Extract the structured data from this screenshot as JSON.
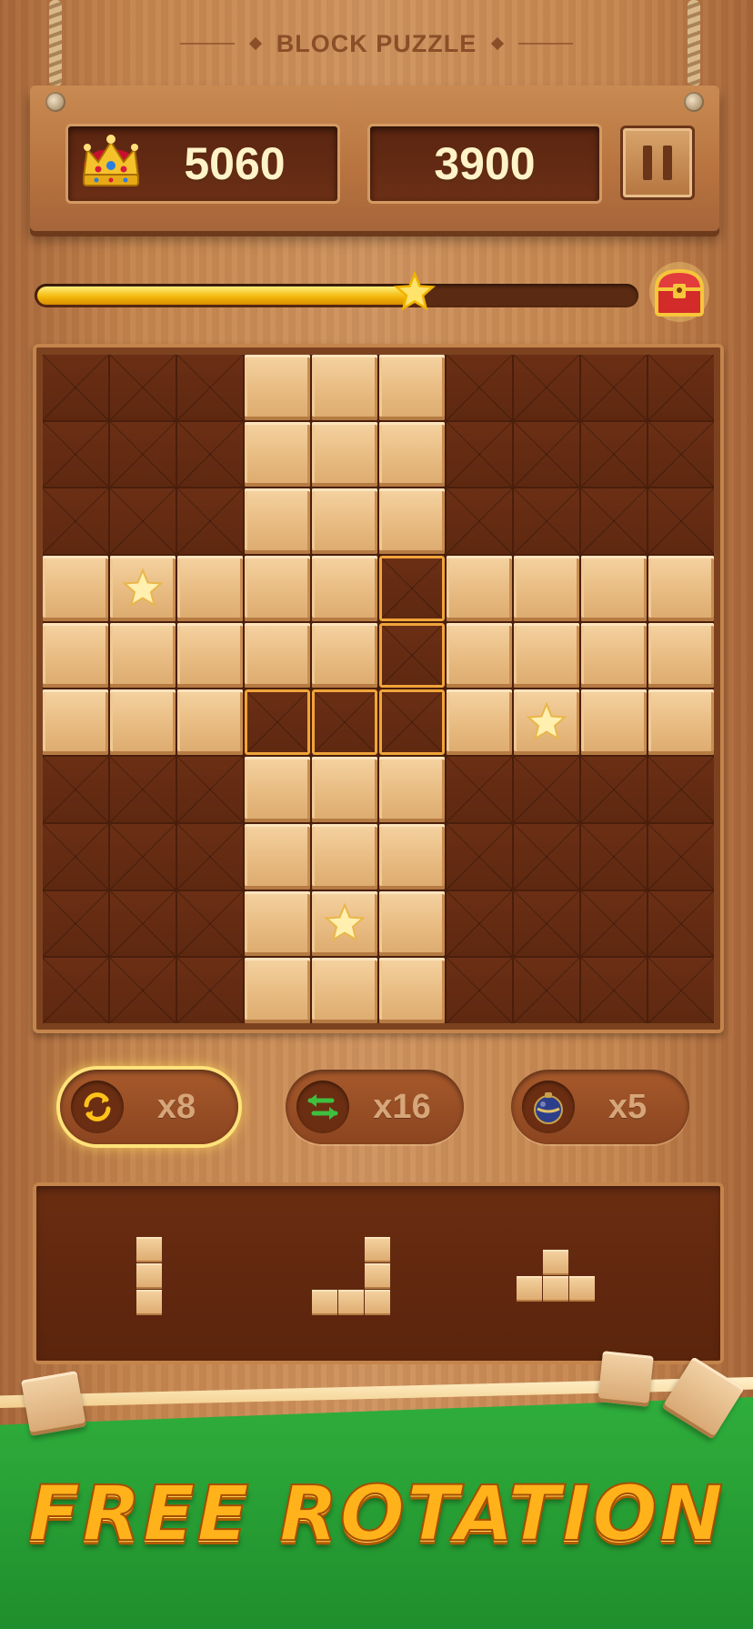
{
  "header": {
    "title": "BLOCK PUZZLE"
  },
  "scores": {
    "best": "5060",
    "current": "3900"
  },
  "progress": {
    "fraction": 0.63
  },
  "board": {
    "rows": [
      "...FFF....",
      "...FFF....",
      "...FFF....",
      "FSFFFHFFFF",
      "FFFFFHFFFF",
      "FFFHHHFSFF",
      "...FFF....",
      "...FFF....",
      "...FSF....",
      "...FFF...."
    ],
    "legend": {
      ".": "empty",
      "F": "wood-block",
      "S": "star-block",
      "H": "placement-hint"
    }
  },
  "boosters": [
    {
      "name": "rotate-booster",
      "icon": "rotate-icon",
      "count": "x8",
      "active": true
    },
    {
      "name": "swap-booster",
      "icon": "swap-arrows-icon",
      "count": "x16",
      "active": false
    },
    {
      "name": "bomb-booster",
      "icon": "bomb-icon",
      "count": "x5",
      "active": false
    }
  ],
  "tray_pieces": [
    "vertical-i3-piece",
    "j-piece",
    "t-piece"
  ],
  "banner": {
    "text": "FREE ROTATION"
  },
  "colors": {
    "accent": "#f4b90e",
    "board_dark": "#5e2810",
    "block_light": "#e9bd84",
    "hint_outline": "#f0a43a",
    "banner": "#ffb21a"
  }
}
